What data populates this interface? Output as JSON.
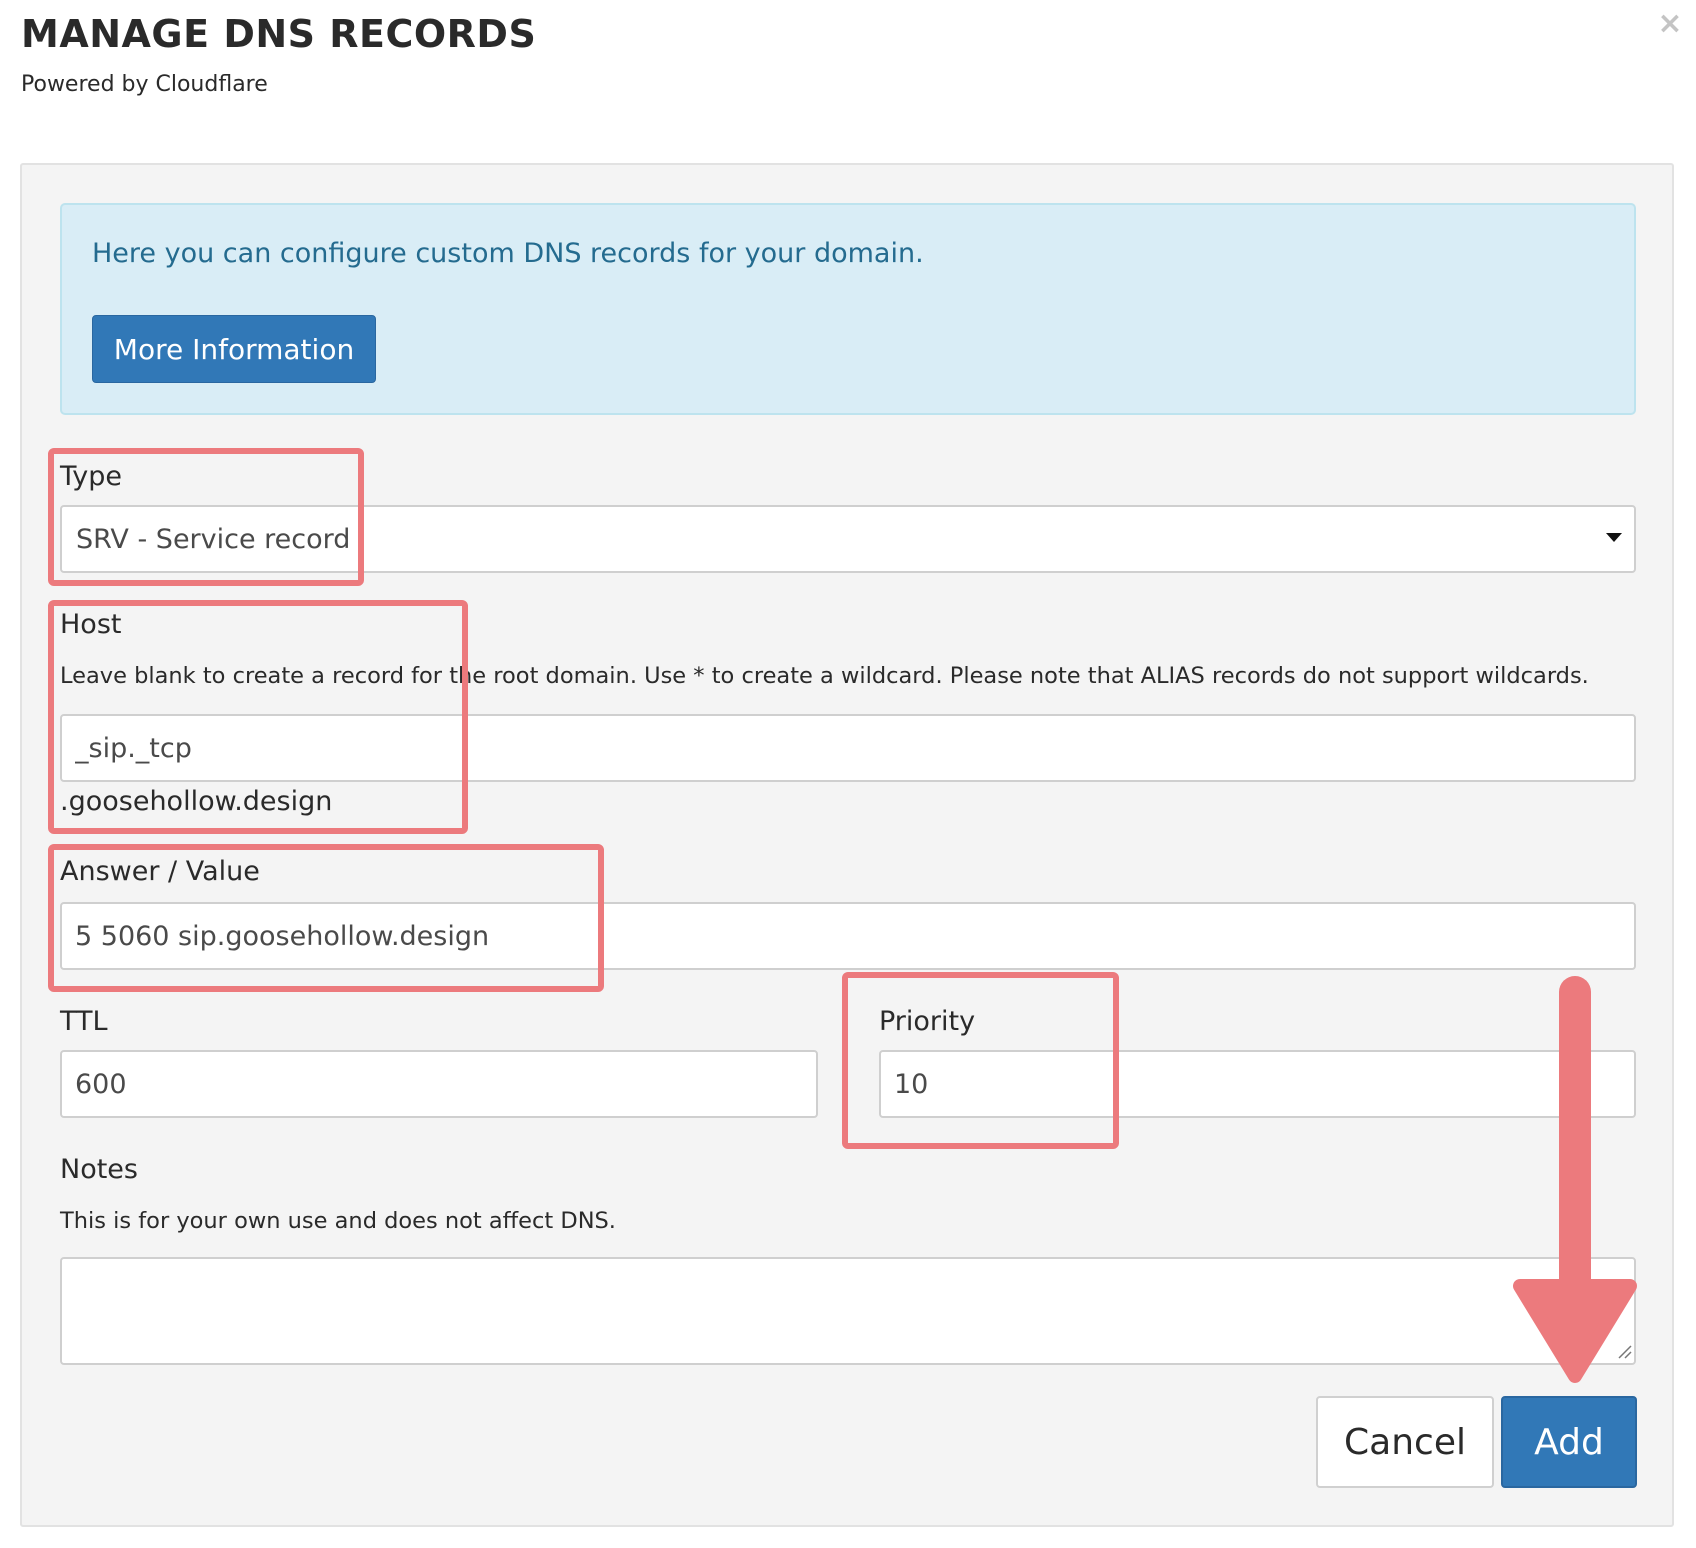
{
  "header": {
    "title": "MANAGE DNS RECORDS",
    "subtitle": "Powered by Cloudflare",
    "close_label": "×"
  },
  "info": {
    "text": "Here you can configure custom DNS records for your domain.",
    "button_label": "More Information"
  },
  "form": {
    "type": {
      "label": "Type",
      "value": "SRV - Service record"
    },
    "host": {
      "label": "Host",
      "help": "Leave blank to create a record for the root domain. Use * to create a wildcard. Please note that ALIAS records do not support wildcards.",
      "value": "_sip._tcp",
      "suffix": ".goosehollow.design"
    },
    "answer": {
      "label": "Answer / Value",
      "value": "5 5060 sip.goosehollow.design"
    },
    "ttl": {
      "label": "TTL",
      "value": "600"
    },
    "priority": {
      "label": "Priority",
      "value": "10"
    },
    "notes": {
      "label": "Notes",
      "help": "This is for your own use and does not affect DNS.",
      "value": ""
    }
  },
  "actions": {
    "cancel_label": "Cancel",
    "add_label": "Add"
  },
  "colors": {
    "primary": "#3178b7",
    "alert_bg": "#d9edf6",
    "alert_text": "#246b8f",
    "highlight": "#ec7a7d"
  },
  "icons": {
    "close": "close-icon",
    "dropdown": "chevron-down-icon",
    "resize": "resize-grip-icon",
    "annotation": "arrow-down-icon"
  }
}
